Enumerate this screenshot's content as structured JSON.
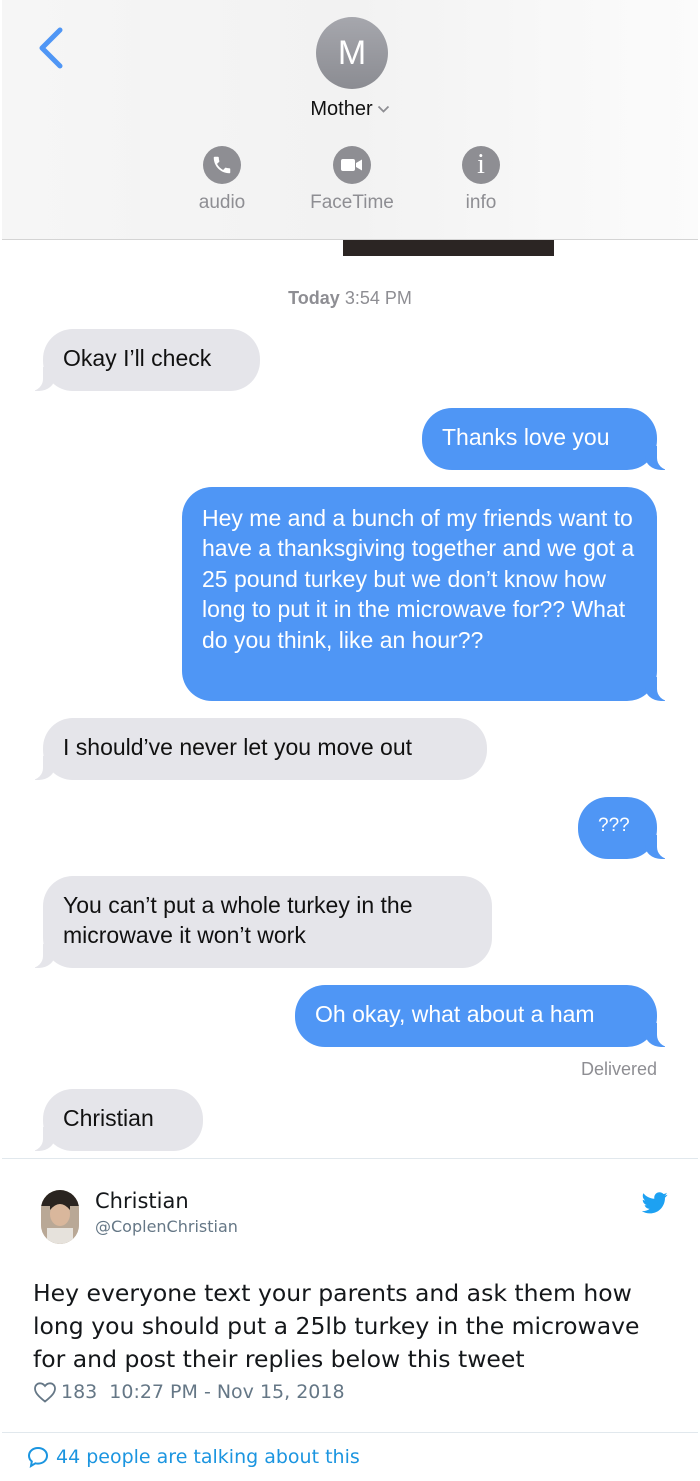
{
  "header": {
    "avatar_initial": "M",
    "contact_name": "Mother",
    "actions": [
      {
        "label": "audio",
        "icon": "phone-icon"
      },
      {
        "label": "FaceTime",
        "icon": "video-camera-icon"
      },
      {
        "label": "info",
        "icon": "info-icon"
      }
    ]
  },
  "conversation": {
    "timestamp_day": "Today",
    "timestamp_time": "3:54 PM",
    "messages": [
      {
        "from": "them",
        "text": "Okay I’ll check"
      },
      {
        "from": "me",
        "text": "Thanks love you"
      },
      {
        "from": "me",
        "text": "Hey me and a bunch of my friends want to have a thanksgiving together and we got a 25 pound turkey but we don’t know how long to put it in the microwave for?? What do you think, like an hour??"
      },
      {
        "from": "them",
        "text": "I should’ve never let you move out"
      },
      {
        "from": "me",
        "text": "???"
      },
      {
        "from": "them",
        "text": "You can’t put a whole turkey in the microwave it won’t work"
      },
      {
        "from": "me",
        "text": "Oh okay, what about a ham"
      },
      {
        "from": "them",
        "text": "Christian"
      }
    ],
    "delivered_label": "Delivered"
  },
  "tweet": {
    "name": "Christian",
    "handle": "@CoplenChristian",
    "text": "Hey everyone text your parents and ask them how long you should put a 25lb turkey in the microwave for and post their replies below this tweet",
    "likes": "183",
    "timestamp": "10:27 PM - Nov 15, 2018",
    "talking": "44 people are talking about this"
  },
  "colors": {
    "ios_blue": "#4f96f5",
    "received_bubble": "#e5e5ea",
    "twitter_blue": "#1da1f2",
    "muted_gray": "#8e8e93"
  }
}
